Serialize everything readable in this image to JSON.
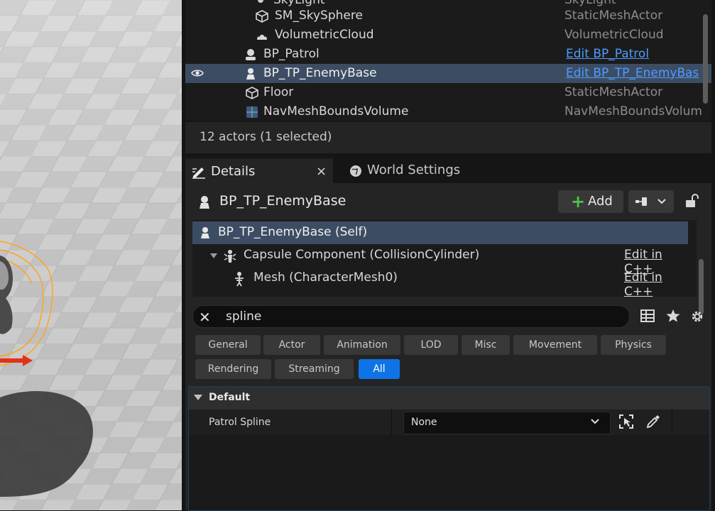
{
  "outliner": {
    "rows": [
      {
        "name": "SkyLight",
        "type": "SkyLight"
      },
      {
        "name": "SM_SkySphere",
        "type": "StaticMeshActor"
      },
      {
        "name": "VolumetricCloud",
        "type": "VolumetricCloud"
      },
      {
        "name": "BP_Patrol",
        "type": "Edit BP_Patrol"
      },
      {
        "name": "BP_TP_EnemyBase",
        "type": "Edit BP_TP_EnemyBas"
      },
      {
        "name": "Floor",
        "type": "StaticMeshActor"
      },
      {
        "name": "NavMeshBoundsVolume",
        "type": "NavMeshBoundsVolum"
      }
    ],
    "status": "12 actors (1 selected)"
  },
  "tabs": {
    "details": "Details",
    "close": "×",
    "world_settings": "World Settings"
  },
  "details": {
    "actor_name": "BP_TP_EnemyBase",
    "add_label": "Add",
    "components": [
      {
        "label": "BP_TP_EnemyBase (Self)",
        "edit": ""
      },
      {
        "label": "Capsule Component (CollisionCylinder)",
        "edit": "Edit in C++"
      },
      {
        "label": "Mesh (CharacterMesh0)",
        "edit": "Edit in C++"
      }
    ],
    "search": {
      "value": "spline",
      "clear": "✕"
    },
    "filters": [
      "General",
      "Actor",
      "Animation",
      "LOD",
      "Misc",
      "Movement",
      "Physics",
      "Rendering",
      "Streaming",
      "All"
    ],
    "active_filter": "All",
    "category": "Default",
    "property": {
      "label": "Patrol Spline",
      "value": "None"
    }
  },
  "colors": {
    "selection": "#3c4d63",
    "link": "#4f9bff",
    "accent": "#0e74e6",
    "add_plus": "#4fc34b"
  }
}
